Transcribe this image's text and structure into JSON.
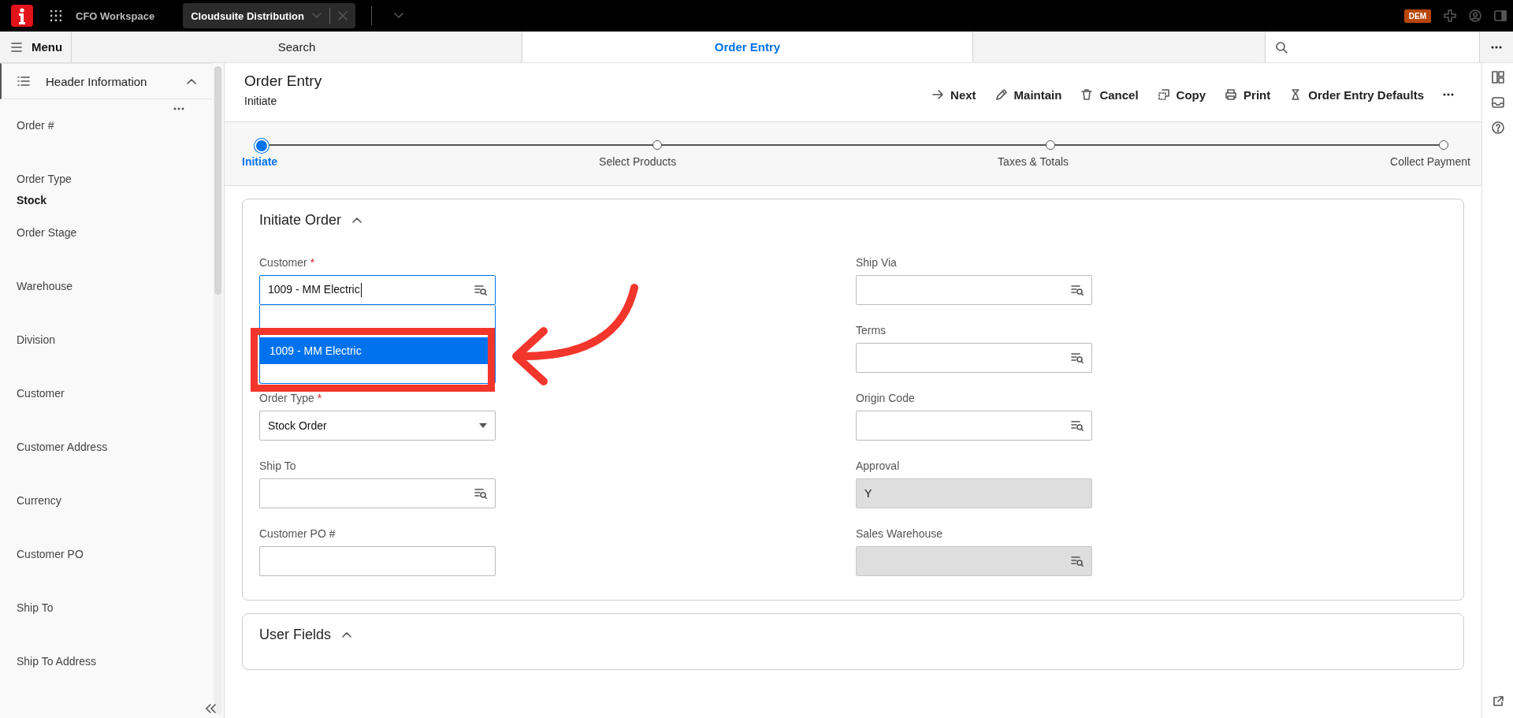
{
  "top_bar": {
    "app_title": "CFO Workspace",
    "context_tab": "Cloudsuite Distribution",
    "badge": "DEM"
  },
  "nav": {
    "menu_label": "Menu",
    "tabs": [
      {
        "label": "Search",
        "selected": false
      },
      {
        "label": "Order Entry",
        "selected": true
      }
    ]
  },
  "sidebar": {
    "title": "Header Information",
    "expanded": true,
    "items": [
      {
        "label": "Order #"
      },
      {
        "label": "Order Type",
        "value": "Stock"
      },
      {
        "label": "Order Stage"
      },
      {
        "label": "Warehouse"
      },
      {
        "label": "Division"
      },
      {
        "label": "Customer"
      },
      {
        "label": "Customer Address"
      },
      {
        "label": "Currency"
      },
      {
        "label": "Customer PO"
      },
      {
        "label": "Ship To"
      },
      {
        "label": "Ship To Address"
      }
    ]
  },
  "page": {
    "title": "Order Entry",
    "subtitle": "Initiate",
    "actions": [
      "Next",
      "Maintain",
      "Cancel",
      "Copy",
      "Print",
      "Order Entry Defaults"
    ]
  },
  "stepper": [
    {
      "label": "Initiate",
      "selected": true
    },
    {
      "label": "Select Products",
      "selected": false
    },
    {
      "label": "Taxes & Totals",
      "selected": false
    },
    {
      "label": "Collect Payment",
      "selected": false
    }
  ],
  "sections": [
    {
      "title": "Initiate Order",
      "expanded": true,
      "left_fields": [
        {
          "label": "Customer",
          "required_mark": "*",
          "kind": "lookup",
          "value": "1009 - MM Electric",
          "focused": true,
          "disabled": false,
          "options": [
            {
              "label": "1009 - MM Electric",
              "selected": true
            }
          ]
        },
        {
          "label": "Order Type",
          "required_mark": "*",
          "kind": "select",
          "value": "Stock Order",
          "focused": false,
          "disabled": false
        },
        {
          "label": "Ship To",
          "kind": "lookup",
          "focused": false,
          "disabled": false
        },
        {
          "label": "Customer PO #",
          "kind": "text",
          "focused": false,
          "disabled": false
        }
      ],
      "right_fields": [
        {
          "label": "Ship Via",
          "kind": "lookup",
          "focused": false,
          "disabled": false
        },
        {
          "label": "Terms",
          "kind": "lookup",
          "focused": false,
          "disabled": false
        },
        {
          "label": "Origin Code",
          "kind": "lookup",
          "focused": false,
          "disabled": false
        },
        {
          "label": "Approval",
          "kind": "text",
          "value": "Y",
          "focused": false,
          "disabled": true
        },
        {
          "label": "Sales Warehouse",
          "kind": "lookup",
          "focused": false,
          "disabled": true
        }
      ]
    },
    {
      "title": "User Fields",
      "expanded": true
    }
  ],
  "annotation": {
    "kind": "highlight"
  }
}
